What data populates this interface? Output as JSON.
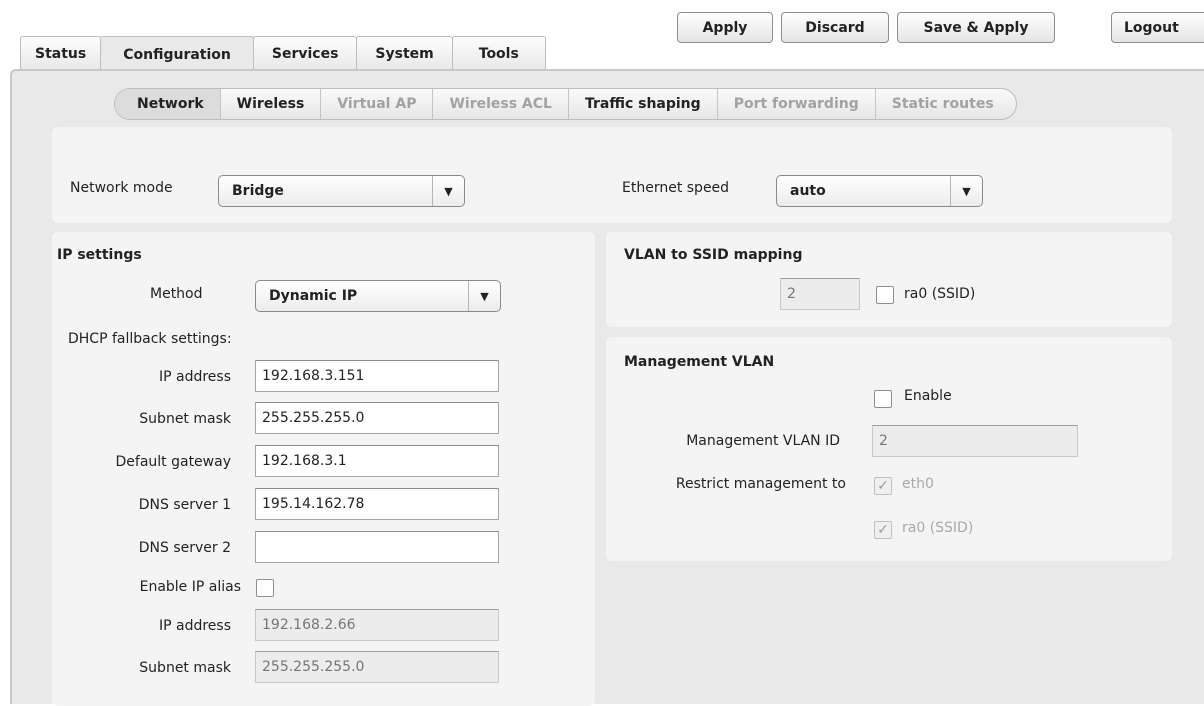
{
  "main_tabs": [
    {
      "label": "Status"
    },
    {
      "label": "Configuration"
    },
    {
      "label": "Services"
    },
    {
      "label": "System"
    },
    {
      "label": "Tools"
    }
  ],
  "top_buttons": {
    "apply": "Apply",
    "discard": "Discard",
    "save_apply": "Save & Apply",
    "logout": "Logout"
  },
  "sub_tabs": [
    {
      "label": "Network",
      "state": "active"
    },
    {
      "label": "Wireless",
      "state": "enabled"
    },
    {
      "label": "Virtual AP",
      "state": "disabled"
    },
    {
      "label": "Wireless ACL",
      "state": "disabled"
    },
    {
      "label": "Traffic shaping",
      "state": "enabled"
    },
    {
      "label": "Port forwarding",
      "state": "disabled"
    },
    {
      "label": "Static routes",
      "state": "disabled"
    }
  ],
  "top_panel": {
    "network_mode_label": "Network mode",
    "network_mode_value": "Bridge",
    "ethernet_speed_label": "Ethernet speed",
    "ethernet_speed_value": "auto"
  },
  "ip_settings": {
    "title": "IP settings",
    "method_label": "Method",
    "method_value": "Dynamic IP",
    "fallback_label": "DHCP fallback settings:",
    "ip_address_label": "IP address",
    "ip_address_value": "192.168.3.151",
    "subnet_mask_label": "Subnet mask",
    "subnet_mask_value": "255.255.255.0",
    "gateway_label": "Default gateway",
    "gateway_value": "192.168.3.1",
    "dns1_label": "DNS server 1",
    "dns1_value": "195.14.162.78",
    "dns2_label": "DNS server 2",
    "dns2_value": "",
    "alias_label": "Enable IP alias",
    "alias_checked": false,
    "alias_ip_label": "IP address",
    "alias_ip_placeholder": "192.168.2.66",
    "alias_mask_label": "Subnet mask",
    "alias_mask_placeholder": "255.255.255.0"
  },
  "vlan_ssid": {
    "title": "VLAN to SSID mapping",
    "vlan_placeholder": "2",
    "ssid_label": "ra0 (SSID)",
    "ssid_checked": false
  },
  "management_vlan": {
    "title": "Management VLAN",
    "enable_label": "Enable",
    "enable_checked": false,
    "vlan_id_label": "Management VLAN ID",
    "vlan_id_placeholder": "2",
    "restrict_label": "Restrict management to",
    "eth0_label": "eth0",
    "eth0_checked": true,
    "ra0_label": "ra0 (SSID)",
    "ra0_checked": true
  },
  "glyphs": {
    "arrow": "▼",
    "check": "✓"
  }
}
